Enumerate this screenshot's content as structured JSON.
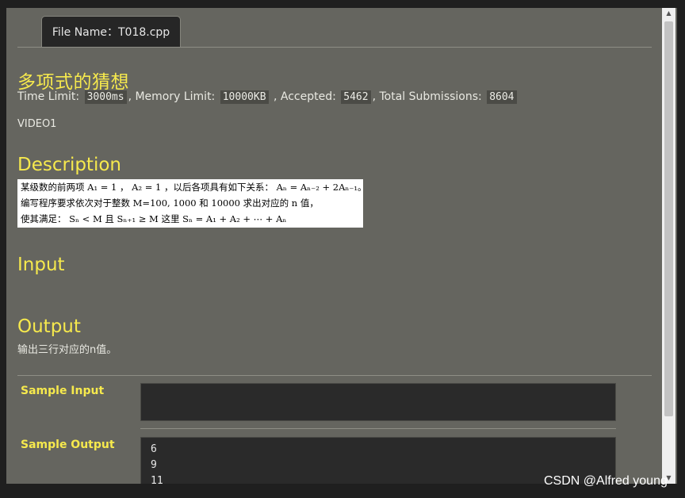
{
  "tab": {
    "label": "File Name：T018.cpp"
  },
  "problem": {
    "title": "多项式的猜想",
    "time_limit_label": "Time Limit:",
    "time_limit": "3000ms",
    "memory_limit_label": ", Memory Limit:",
    "memory_limit": "10000KB",
    "accepted_label": ", Accepted:",
    "accepted": "5462",
    "submissions_label": ", Total Submissions:",
    "submissions": "8604",
    "source": "VIDEO1"
  },
  "sections": {
    "description": "Description",
    "input": "Input",
    "output": "Output"
  },
  "description_lines": [
    "某级数的前两项 A₁ = 1 ， A₂ = 1 ，以后各项具有如下关系： Aₙ = Aₙ₋₂ + 2Aₙ₋₁。",
    "编写程序要求依次对于整数 M=100, 1000 和 10000 求出对应的 n 值，",
    "使其满足： Sₙ < M 且 Sₙ₊₁ ≥ M  这里 Sₙ = A₁ + A₂ + ⋯ + Aₙ"
  ],
  "output_text": "输出三行对应的n值。",
  "sample": {
    "input_label": "Sample Input",
    "output_label": "Sample Output",
    "output_lines": [
      "6",
      "9",
      "11"
    ]
  },
  "watermark": "CSDN @Alfred young"
}
